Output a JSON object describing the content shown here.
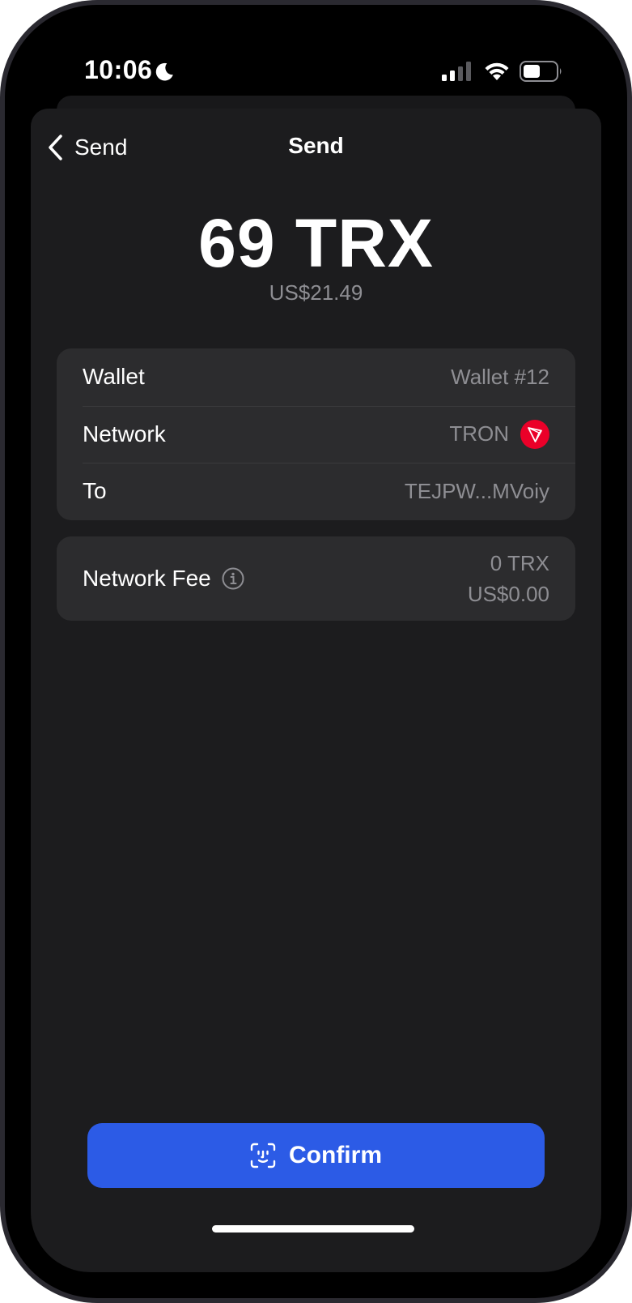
{
  "status_bar": {
    "time": "10:06",
    "icons": [
      "moon-icon",
      "signal-icon",
      "wifi-icon",
      "battery-icon"
    ]
  },
  "nav": {
    "back_label": "Send",
    "title": "Send",
    "back_icon": "chevron-left-icon"
  },
  "amount": {
    "value": "69 TRX",
    "fiat": "US$21.49"
  },
  "details": {
    "wallet_label": "Wallet",
    "wallet_value": "Wallet #12",
    "network_label": "Network",
    "network_value": "TRON",
    "network_icon": "tron-icon",
    "to_label": "To",
    "to_value": "TEJPW...MVoiy"
  },
  "fee": {
    "label": "Network Fee",
    "icon": "info-icon",
    "crypto": "0 TRX",
    "fiat": "US$0.00"
  },
  "confirm": {
    "label": "Confirm",
    "icon": "faceid-icon"
  },
  "colors": {
    "accent": "#2c5be6",
    "tron": "#eb0029",
    "background": "#1c1c1e",
    "card": "#2c2c2e",
    "secondary_text": "#8e8e93"
  }
}
